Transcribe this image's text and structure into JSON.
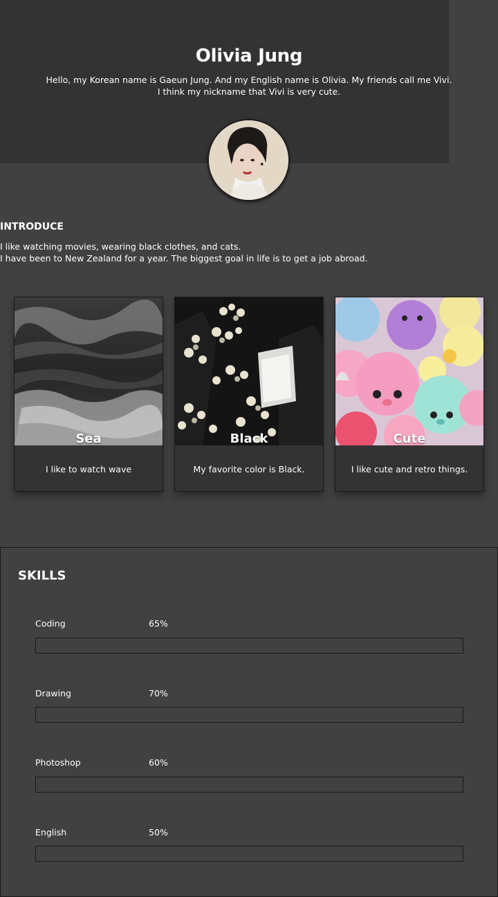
{
  "profile": {
    "name": "Olivia Jung",
    "bio_line1": "Hello, my Korean name is Gaeun Jung. And my English name is Olivia. My friends call me Vivi.",
    "bio_line2": "I think my nickname that Vivi is very cute."
  },
  "introduce": {
    "title": "INTRODUCE",
    "line1": "I like watching movies, wearing black clothes, and cats.",
    "line2": "I have been to New Zealand for a year. The biggest goal in life is to get a job abroad."
  },
  "cards": [
    {
      "title": "Sea",
      "description": "I like to watch wave"
    },
    {
      "title": "Black",
      "description": "My favorite color is Black."
    },
    {
      "title": "Cute",
      "description": "I like cute and retro things."
    }
  ],
  "skills": {
    "title": "SKILLS",
    "items": [
      {
        "name": "Coding",
        "percent_label": "65%",
        "level": 0.65
      },
      {
        "name": "Drawing",
        "percent_label": "70%",
        "level": 0.7
      },
      {
        "name": "Photoshop",
        "percent_label": "60%",
        "level": 0.6
      },
      {
        "name": "English",
        "percent_label": "50%",
        "level": 0.5
      }
    ]
  },
  "colors": {
    "page_background": "#414141",
    "header_background": "#333333",
    "card_background": "#333333",
    "text": "#ffffff"
  }
}
